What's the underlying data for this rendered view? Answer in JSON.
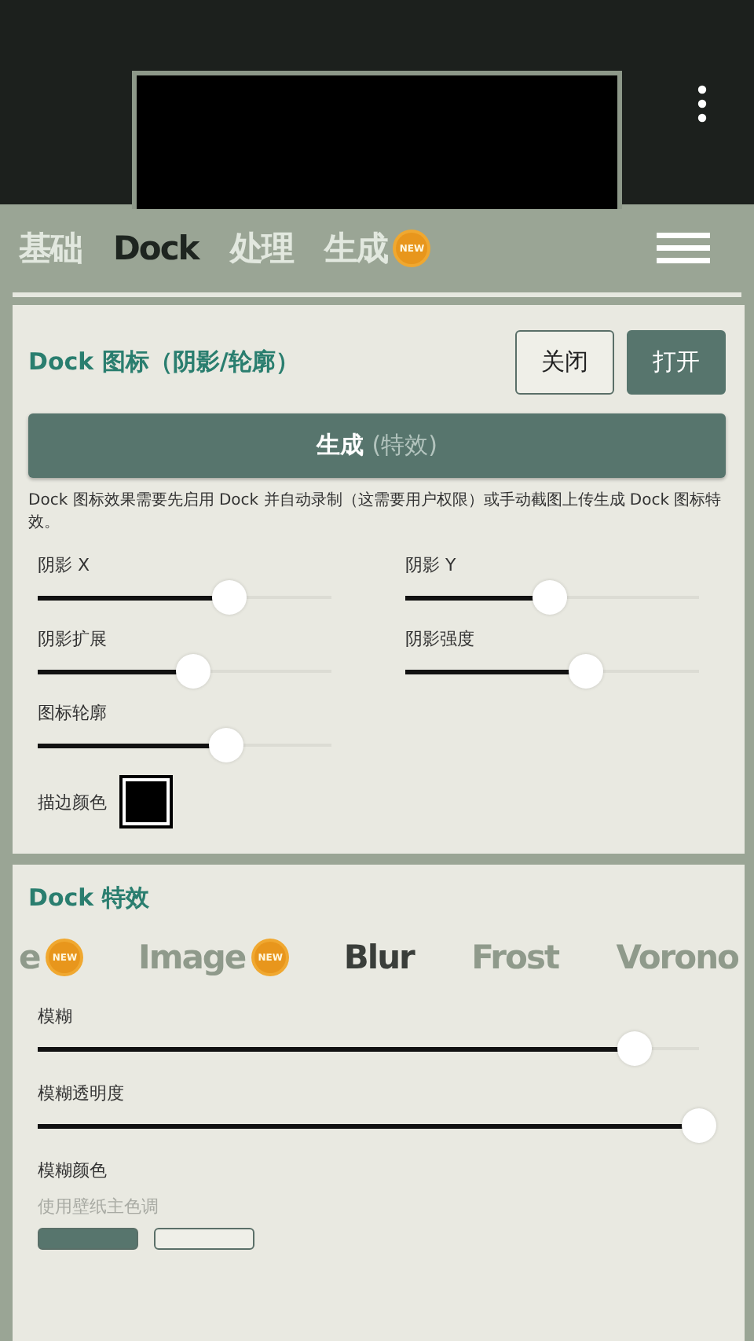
{
  "tabs": [
    {
      "label": "基础",
      "selected": false
    },
    {
      "label": "Dock",
      "selected": true
    },
    {
      "label": "处理",
      "selected": false
    },
    {
      "label": "生成",
      "selected": false,
      "badge": "NEW"
    }
  ],
  "icon_section": {
    "title": "Dock 图标（阴影/轮廓）",
    "toggle": [
      {
        "label": "关闭",
        "selected": false
      },
      {
        "label": "打开",
        "selected": true
      }
    ],
    "generate_button": {
      "label": "生成",
      "hint": "(特效)"
    },
    "note": "Dock 图标效果需要先启用 Dock 并自动录制（这需要用户权限）或手动截图上传生成 Dock 图标特效。",
    "sliders": [
      {
        "label": "阴影 X",
        "level": 0.63
      },
      {
        "label": "阴影 Y",
        "level": 0.46
      },
      {
        "label": "阴影扩展",
        "level": 0.5
      },
      {
        "label": "阴影强度",
        "level": 0.59
      },
      {
        "label": "图标轮廓",
        "level": 0.62
      }
    ],
    "stroke_color": {
      "label": "描边颜色",
      "color": "#000000"
    }
  },
  "effects_section": {
    "title": "Dock 特效",
    "effects": [
      {
        "label": "e",
        "selected": false,
        "badge": "NEW"
      },
      {
        "label": "Image",
        "selected": false,
        "badge": "NEW"
      },
      {
        "label": "Blur",
        "selected": true
      },
      {
        "label": "Frost",
        "selected": false
      },
      {
        "label": "Vorono",
        "selected": false
      }
    ],
    "sliders": [
      {
        "label": "模糊",
        "level": 0.9
      },
      {
        "label": "模糊透明度",
        "level": 1.0
      }
    ],
    "blur_color": {
      "label": "模糊颜色",
      "hint": "使用壁纸主色调"
    },
    "choices": [
      {
        "selected": true
      },
      {
        "selected": false
      }
    ]
  }
}
